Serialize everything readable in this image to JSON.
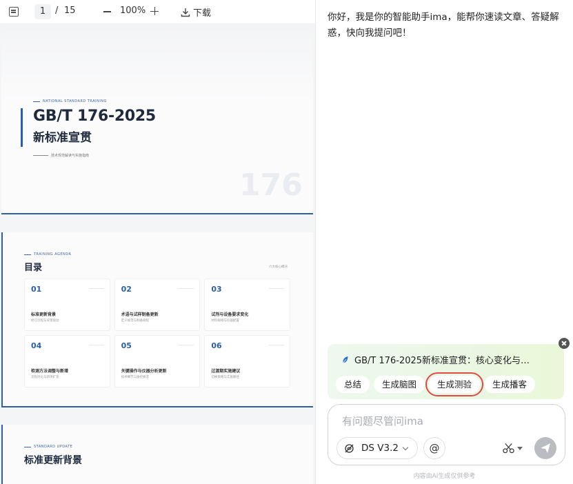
{
  "toolbar": {
    "current_page": "1",
    "separator": "/",
    "total_pages": "15",
    "zoom": "100%",
    "download_label": "下载"
  },
  "pdf": {
    "page1": {
      "kicker": "NATIONAL STANDARD TRAINING",
      "title": "GB/T 176-2025",
      "subtitle": "新标准宣贯",
      "note": "技术规范解读与实施指南",
      "watermark": "176"
    },
    "page2": {
      "kicker": "TRAINING AGENDA",
      "title": "目录",
      "side_note": "六大核心模块",
      "cards": [
        {
          "num": "01",
          "title": "标准更新背景",
          "desc": "修订历程与背景驱动"
        },
        {
          "num": "02",
          "title": "术语与试样制备更新",
          "desc": "定义规范与制备规程"
        },
        {
          "num": "03",
          "title": "试剂与设备要求变化",
          "desc": "材料规格与仪器配置"
        },
        {
          "num": "04",
          "title": "检测方法调整与新增",
          "desc": "流程优化与新项扩充"
        },
        {
          "num": "05",
          "title": "关键操作与仪器分析更新",
          "desc": "技术细节与质控要求"
        },
        {
          "num": "06",
          "title": "过渡期实施建议",
          "desc": "切换策略与实施路径"
        }
      ]
    },
    "page3": {
      "kicker": "STANDARD UPDATE",
      "title": "标准更新背景"
    }
  },
  "assistant": {
    "greeting": "你好，我是你的智能助手ima，能帮你速读文章、答疑解惑，快向我提问吧！",
    "doc_title": "GB/T 176-2025新标准宣贯：核心变化与…",
    "chips": [
      "总结",
      "生成脑图",
      "生成测验",
      "生成播客"
    ],
    "input_placeholder": "有问题尽管问ima",
    "model_label": "DS V3.2",
    "at_label": "@",
    "disclaimer": "内容由AI生成仅供参考"
  },
  "colors": {
    "accent_blue": "#2c5ea8",
    "highlight_red": "#e04a43",
    "doc_card_green": "#eaf8e4"
  }
}
